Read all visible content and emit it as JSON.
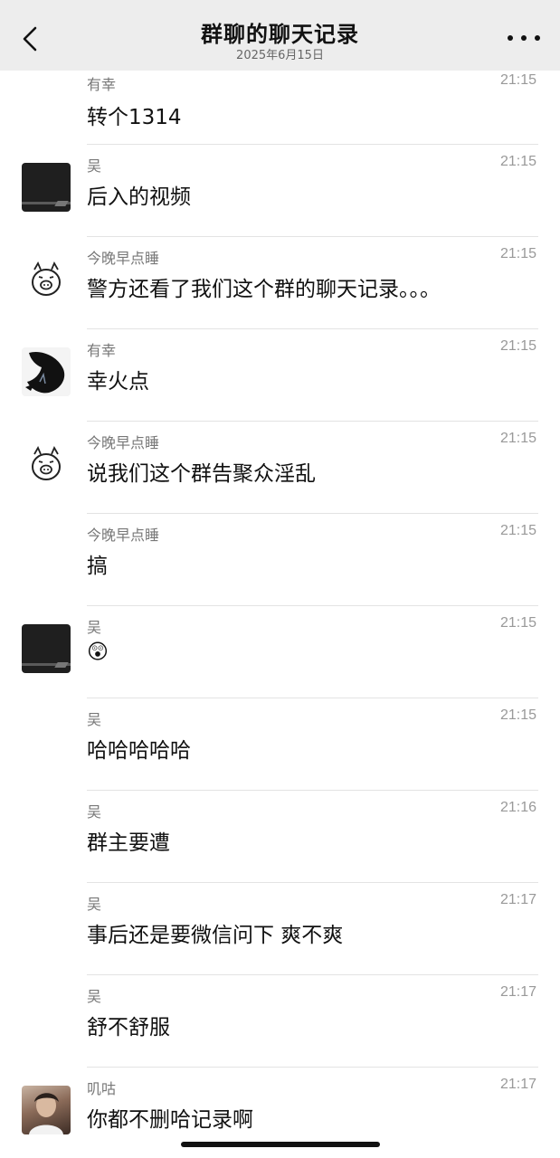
{
  "header": {
    "title": "群聊的聊天记录",
    "date": "2025年6月15日"
  },
  "messages": [
    {
      "sender": "有幸",
      "time": "21:15",
      "text": "转个1314",
      "avatar": "none"
    },
    {
      "sender": "吴",
      "time": "21:15",
      "text": "后入的视频",
      "avatar": "dark-screen-avatar"
    },
    {
      "sender": "今晚早点睡",
      "time": "21:15",
      "text": "警方还看了我们这个群的聊天记录。。。",
      "avatar": "pig-doodle-avatar"
    },
    {
      "sender": "有幸",
      "time": "21:15",
      "text": "幸火点",
      "avatar": "dark-figure-avatar"
    },
    {
      "sender": "今晚早点睡",
      "time": "21:15",
      "text": "说我们这个群告聚众淫乱",
      "avatar": "pig-doodle-avatar"
    },
    {
      "sender": "今晚早点睡",
      "time": "21:15",
      "text": "搞",
      "avatar": "none"
    },
    {
      "sender": "吴",
      "time": "21:15",
      "text": "",
      "emoji": "😲",
      "avatar": "dark-screen-avatar"
    },
    {
      "sender": "吴",
      "time": "21:15",
      "text": "哈哈哈哈哈",
      "avatar": "none"
    },
    {
      "sender": "吴",
      "time": "21:16",
      "text": "群主要遭",
      "avatar": "none"
    },
    {
      "sender": "吴",
      "time": "21:17",
      "text": "事后还是要微信问下 爽不爽",
      "avatar": "none"
    },
    {
      "sender": "吴",
      "time": "21:17",
      "text": "舒不舒服",
      "avatar": "none"
    },
    {
      "sender": "叽咕",
      "time": "21:17",
      "text": "你都不删哈记录啊",
      "avatar": "photo-avatar"
    }
  ]
}
